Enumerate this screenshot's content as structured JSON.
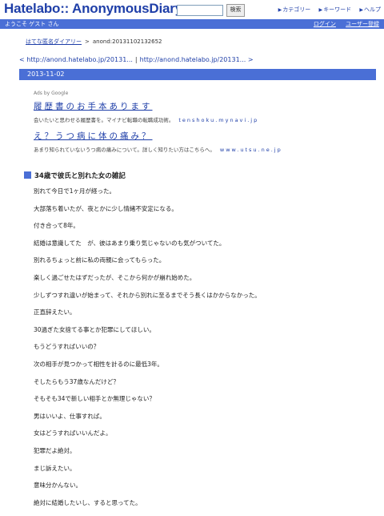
{
  "header": {
    "logo": "Hatelabo:: AnonymousDiary",
    "search_value": "",
    "search_button": "検索",
    "links": [
      {
        "icon": "arrow-icon",
        "label": "カテゴリー"
      },
      {
        "icon": "arrow-icon",
        "label": "キーワード"
      },
      {
        "icon": "arrow-icon",
        "label": "ヘルプ"
      }
    ]
  },
  "userbar": {
    "welcome": "ようこそ ゲスト さん",
    "login": "ログイン",
    "register": "ユーザー登録"
  },
  "breadcrumb": {
    "home": "はてな匿名ダイアリー",
    "separator": ">",
    "current": "anond:20131102132652"
  },
  "nav": {
    "prev": "< http://anond.hatelabo.jp/20131...",
    "separator": "|",
    "next": "http://anond.hatelabo.jp/20131... >"
  },
  "date": "2013-11-02",
  "ads": {
    "label": "Ads by Google",
    "items": [
      {
        "title": "履歴書のお手本あります",
        "text": "会いたいと思わせる履歴書を。マイナビ転職の転職成功術。",
        "url": "tenshoku.mynavi.jp"
      },
      {
        "title": "え？うつ病に体の痛み？",
        "text": "あまり知られていないうつ病の痛みについて。詳しく知りたい方はこちらへ。",
        "url": "www.utsu.ne.jp"
      }
    ]
  },
  "entry": {
    "title": "34歳で彼氏と別れた女の雑記",
    "lines": [
      "別れて今日で1ヶ月が経った。",
      "大部落ち着いたが、夜とかに少し情緒不安定になる。",
      "付き合って8年。",
      "結婚は意識してた　が、彼はあまり乗り気じゃないのも気がついてた。",
      "別れるちょっと前に私の両親に会ってもらった。",
      "楽しく過ごせたはずだったが、そこから何かが崩れ始めた。",
      "少しずつすれ違いが始まって、それから別れに至るまでそう長くはかからなかった。",
      "正直辞えたい。",
      "30過ぎた女捨てる事とか犯罪にしてほしい。",
      "もうどうすればいいの？",
      "次の相手が見つかって相性を計るのに最低3年。",
      "そしたらもう37歳なんだけど？",
      "そもそも34で新しい相手とか無理じゃない？",
      "男はいいよ、仕事すれば。",
      "女はどうすればいいんだよ。",
      "犯罪だよ絶対。",
      "まじ訴えたい。",
      "意味分かんない。",
      "絶対に結婚したいし、すると思ってた。"
    ]
  }
}
